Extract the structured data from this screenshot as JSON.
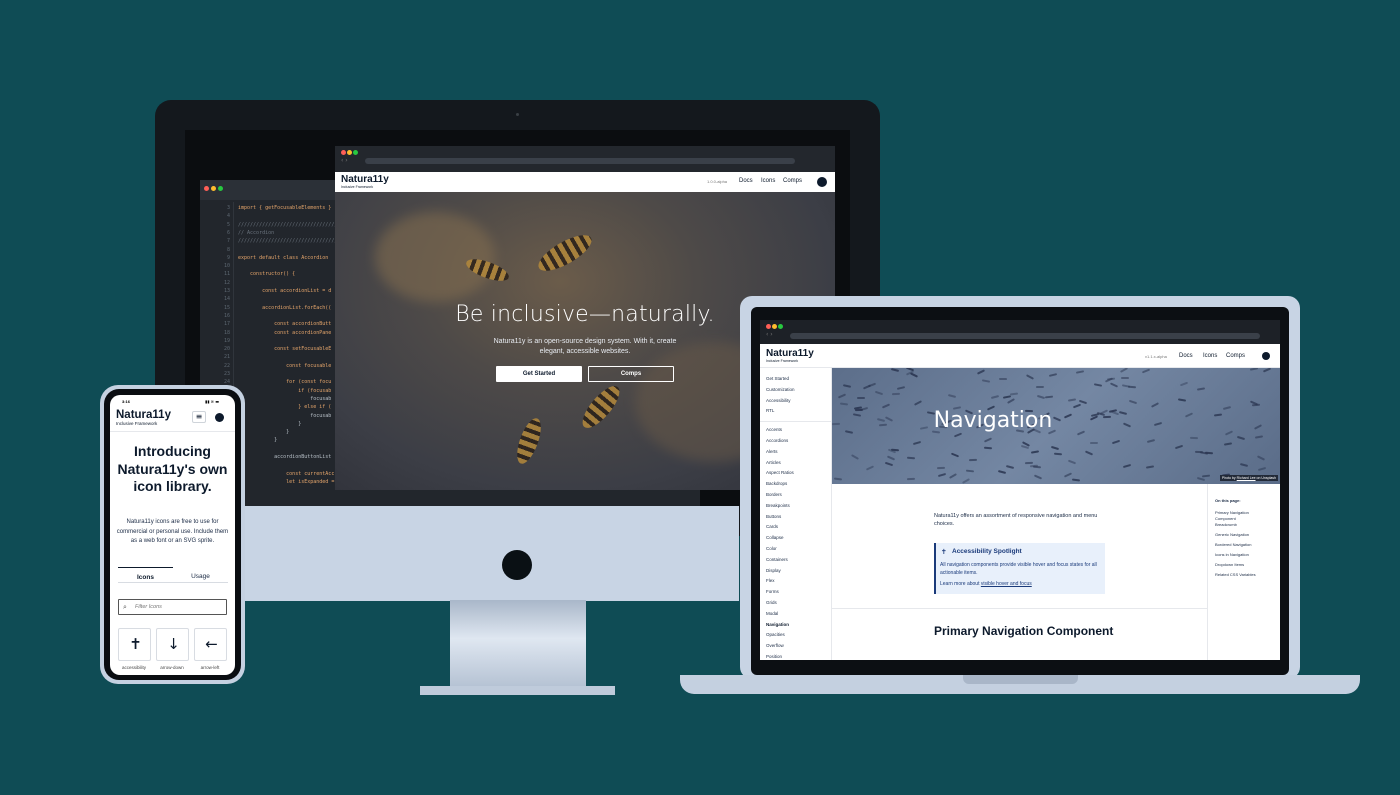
{
  "brand": {
    "name": "Natura11y",
    "tagline": "Inclusive Framework"
  },
  "desktop_site": {
    "version": "1.0.0-alpha",
    "nav": [
      "Docs",
      "Icons",
      "Comps"
    ],
    "hero_title": "Be inclusive—naturally.",
    "hero_text": "Natura11y is an open-source design system. With it, create elegant, accessible websites.",
    "primary_button": "Get Started",
    "secondary_button": "Comps"
  },
  "code_editor": {
    "lines": [
      {
        "n": "3",
        "text": "import { getFocusableElements }"
      },
      {
        "n": "4",
        "text": ""
      },
      {
        "n": "5",
        "text": "////////////////////////////////////////"
      },
      {
        "n": "6",
        "text": "// Accordion"
      },
      {
        "n": "7",
        "text": "////////////////////////////////////////"
      },
      {
        "n": "8",
        "text": ""
      },
      {
        "n": "9",
        "text": "export default class Accordion"
      },
      {
        "n": "10",
        "text": ""
      },
      {
        "n": "11",
        "text": "    constructor() {"
      },
      {
        "n": "12",
        "text": ""
      },
      {
        "n": "13",
        "text": "        const accordionList = d"
      },
      {
        "n": "14",
        "text": ""
      },
      {
        "n": "15",
        "text": "        accordionList.forEach(("
      },
      {
        "n": "16",
        "text": ""
      },
      {
        "n": "17",
        "text": "            const accordionButt"
      },
      {
        "n": "18",
        "text": "            const accordionPane"
      },
      {
        "n": "19",
        "text": ""
      },
      {
        "n": "20",
        "text": "            const setFocusableE"
      },
      {
        "n": "21",
        "text": ""
      },
      {
        "n": "22",
        "text": "                const focusable"
      },
      {
        "n": "23",
        "text": ""
      },
      {
        "n": "24",
        "text": "                for (const focu"
      },
      {
        "n": "25",
        "text": "                    if (focusab"
      },
      {
        "n": "26",
        "text": "                        focusab"
      },
      {
        "n": "27",
        "text": "                    } else if ("
      },
      {
        "n": "28",
        "text": "                        focusab"
      },
      {
        "n": "29",
        "text": "                    }"
      },
      {
        "n": "30",
        "text": "                }"
      },
      {
        "n": "31",
        "text": "            }"
      },
      {
        "n": "32",
        "text": ""
      },
      {
        "n": "33",
        "text": "            accordionButtonList"
      },
      {
        "n": "34",
        "text": ""
      },
      {
        "n": "35",
        "text": "                const currentAcc"
      },
      {
        "n": "36",
        "text": "                let isExpanded = accordionButton.getAttribute('aria-expanded');"
      }
    ]
  },
  "laptop_site": {
    "version": "v1.1.x-alpha",
    "nav": [
      "Docs",
      "Icons",
      "Comps"
    ],
    "sidebar_top": [
      "Get Started",
      "Customization",
      "Accessibility",
      "RTL"
    ],
    "sidebar_components": [
      "Accents",
      "Accordions",
      "Alerts",
      "Articles",
      "Aspect Ratios",
      "Backdrops",
      "Borders",
      "Breakpoints",
      "Buttons",
      "Cards",
      "Collapse",
      "Color",
      "Containers",
      "Display",
      "Flex",
      "Forms",
      "Grids",
      "Modal",
      "Navigation",
      "Opacities",
      "Overflow",
      "Position"
    ],
    "active_item": "Navigation",
    "hero_title": "Navigation",
    "photo_credit": {
      "prefix": "Photo by",
      "author": "Richard Lee",
      "suffix": "on Unsplash"
    },
    "intro": "Natura11y offers an assortment of responsive navigation and menu choices.",
    "spotlight": {
      "title": "Accessibility Spotlight",
      "text": "All navigation components provide visible hover and focus states for all actionable items.",
      "more_prefix": "Learn more about",
      "more_link": "visible hover and focus"
    },
    "section_heading": "Primary Navigation Component",
    "toc_title": "On this page:",
    "toc": [
      "Primary Navigation Component",
      "Breadcrumb",
      "Generic Navigation",
      "Bordered Navigation",
      "Icons in Navigation",
      "Dropdown Items",
      "Related CSS Variables"
    ]
  },
  "phone_site": {
    "status_time": "3:16",
    "headline": "Introducing Natura11y's own icon library.",
    "text": "Natura11y icons are free to use for commercial or personal use. Include them as a web font or an SVG sprite.",
    "tabs": [
      "Icons",
      "Usage"
    ],
    "active_tab": "Icons",
    "filter_placeholder": "Filter Icons",
    "icons": [
      {
        "label": "accessibility",
        "icon": "accessibility-icon"
      },
      {
        "label": "arrow-down",
        "icon": "arrow-down-icon"
      },
      {
        "label": "arrow-left",
        "icon": "arrow-left-icon"
      }
    ]
  },
  "colors": {
    "background": "#0f4c55",
    "brand_dark": "#0d1a2c",
    "spotlight_bg": "#e8f0fb",
    "device_silver": "#c8d4e4"
  }
}
